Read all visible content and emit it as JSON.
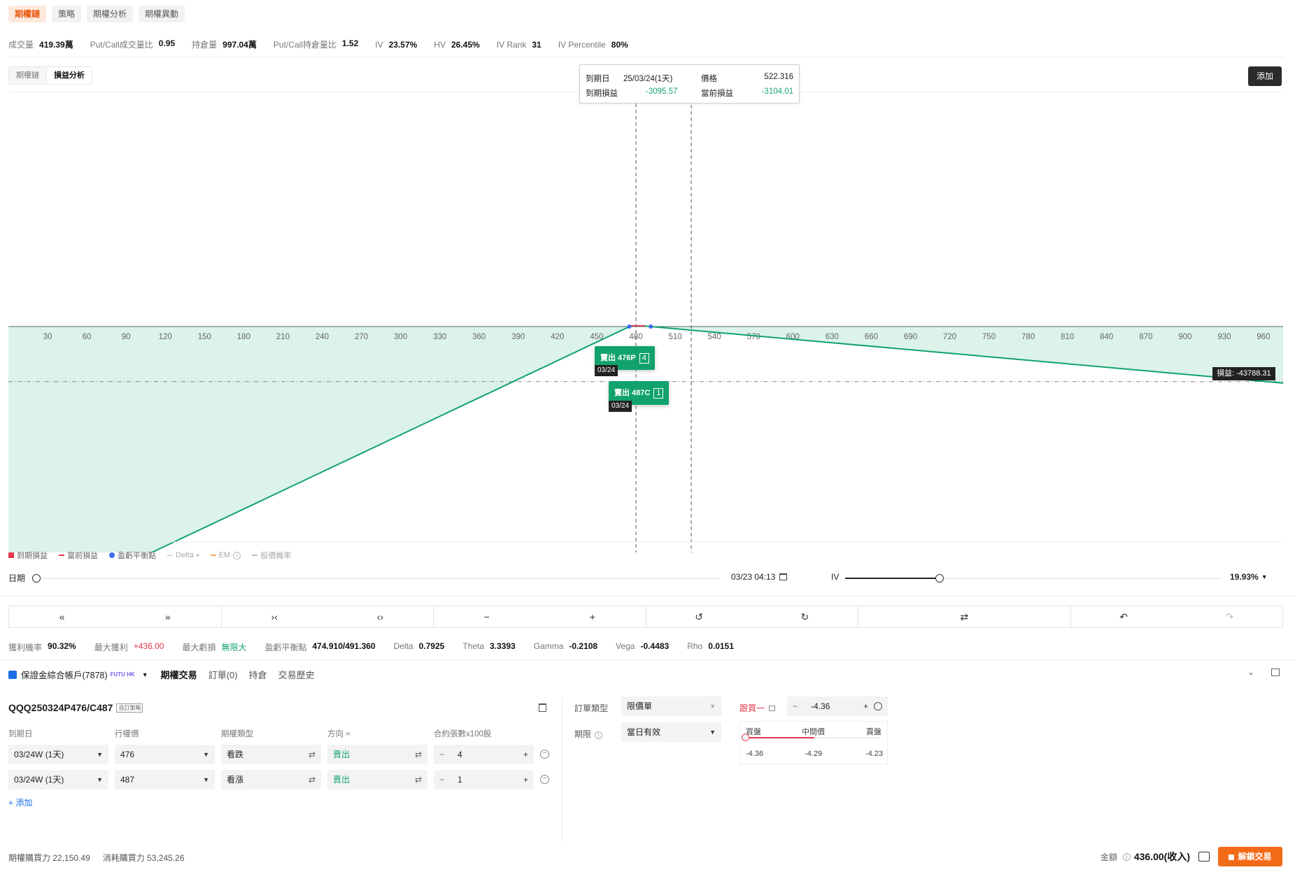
{
  "top_tabs": [
    "期權鏈",
    "策略",
    "期權分析",
    "期權異動"
  ],
  "stats": [
    {
      "label": "成交量",
      "value": "419.39萬"
    },
    {
      "label": "Put/Call成交量比",
      "value": "0.95"
    },
    {
      "label": "持倉量",
      "value": "997.04萬"
    },
    {
      "label": "Put/Call持倉量比",
      "value": "1.52"
    },
    {
      "label": "IV",
      "value": "23.57%"
    },
    {
      "label": "HV",
      "value": "26.45%"
    },
    {
      "label": "IV Rank",
      "value": "31"
    },
    {
      "label": "IV Percentile",
      "value": "80%"
    }
  ],
  "view_toggle": {
    "chain": "期權鏈",
    "pnl": "損益分析"
  },
  "add_button": "添加",
  "tooltip": {
    "expiry_label": "到期日",
    "expiry_value": "25/03/24(1天)",
    "price_label": "價格",
    "price_value": "522.316",
    "exp_pnl_label": "到期損益",
    "exp_pnl_value": "-3095.57",
    "cur_pnl_label": "當前損益",
    "cur_pnl_value": "-3104.01"
  },
  "chart_data": {
    "type": "line",
    "xticks": [
      30,
      60,
      90,
      120,
      150,
      180,
      210,
      240,
      270,
      300,
      330,
      360,
      390,
      420,
      450,
      480,
      510,
      540,
      570,
      600,
      630,
      660,
      690,
      720,
      750,
      780,
      810,
      840,
      870,
      900,
      930,
      960
    ],
    "series": [
      {
        "name": "到期損益",
        "x": [
          0,
          476,
          487,
          975
        ],
        "y": [
          -233640,
          436,
          436,
          -44960
        ]
      }
    ],
    "hover_price": 522.316,
    "current_price": 480,
    "hover_pnl": -43788.31
  },
  "legs": [
    {
      "label": "賣出 476P",
      "qty": "4",
      "date": "03/24"
    },
    {
      "label": "賣出 487C",
      "qty": "1",
      "date": "03/24"
    }
  ],
  "pnl_badge": "損益: -43788.31",
  "legend": [
    {
      "label": "到期損益",
      "color": "#e3384d"
    },
    {
      "label": "當前損益",
      "color": "#e3384d"
    },
    {
      "label": "盈虧平衡點",
      "color": "#3a6ff0"
    },
    {
      "label": "Delta",
      "color": "#bbbbbb"
    },
    {
      "label": "EM",
      "color": "#f5a25a"
    },
    {
      "label": "股價機率",
      "color": "#bbbbbb"
    }
  ],
  "slider": {
    "date_label": "日期",
    "date_value": "03/23 04:13",
    "iv_label": "IV",
    "iv_value": "19.93%",
    "date_level": 0,
    "iv_level": 0.25
  },
  "metrics": [
    {
      "label": "獲利機率",
      "value": "90.32%"
    },
    {
      "label": "最大獲利",
      "value": "+436.00",
      "color": "red"
    },
    {
      "label": "最大虧損",
      "value": "無限大",
      "color": "grn"
    },
    {
      "label": "盈虧平衡點",
      "value": "474.910/491.360"
    },
    {
      "label": "Delta",
      "value": "0.7925"
    },
    {
      "label": "Theta",
      "value": "3.3393"
    },
    {
      "label": "Gamma",
      "value": "-0.2108"
    },
    {
      "label": "Vega",
      "value": "-0.4483"
    },
    {
      "label": "Rho",
      "value": "0.0151"
    }
  ],
  "account": {
    "name": "保證金綜合帳戶(7878)",
    "badge": "FUTU HK",
    "tabs": [
      "期權交易",
      "訂單(0)",
      "持倉",
      "交易歷史"
    ]
  },
  "order": {
    "symbol": "QQQ250324P476/C487",
    "symbol_tag": "自訂策略",
    "headers": [
      "到期日",
      "行權價",
      "期權類型",
      "方向 ≈",
      "合約張數x100股"
    ],
    "rows": [
      {
        "expiry": "03/24W (1天)",
        "strike": "476",
        "type": "看跌",
        "side": "賣出",
        "qty": "4"
      },
      {
        "expiry": "03/24W (1天)",
        "strike": "487",
        "type": "看漲",
        "side": "賣出",
        "qty": "1"
      }
    ],
    "add_link": "+ 添加"
  },
  "right_form": {
    "order_type_label": "訂單類型",
    "order_type_value": "限價單",
    "tif_label": "期限",
    "tif_value": "當日有效",
    "follow_label": "跟買一",
    "price_value": "-4.36",
    "bid_label": "買盤",
    "mid_label": "中間價",
    "ask_label": "賣盤",
    "bid_value": "-4.36",
    "mid_value": "-4.29",
    "ask_value": "-4.23"
  },
  "footer": {
    "bp_label": "期權購買力",
    "bp_value": "22,150.49",
    "consume_label": "消耗購買力",
    "consume_value": "53,245.26",
    "amount_label": "金額",
    "amount_value": "436.00(收入)",
    "unlock_label": "解鎖交易"
  }
}
